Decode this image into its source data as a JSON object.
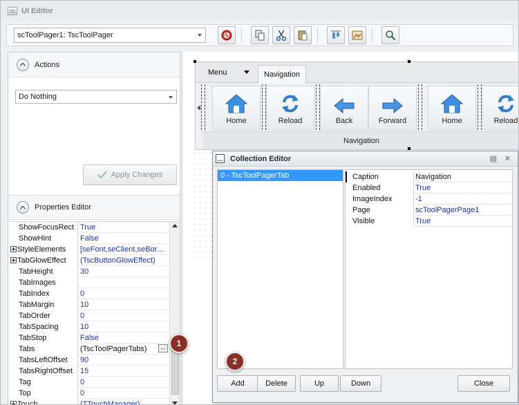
{
  "window": {
    "title": "UI Editor"
  },
  "toolbar": {
    "component_select": {
      "value": "scToolPager1: TscToolPager"
    },
    "buttons": [
      "delete-icon",
      "copy-icon",
      "cut-icon",
      "paste-icon",
      "align-icon",
      "image-icon",
      "search-icon"
    ]
  },
  "actions": {
    "header": "Actions",
    "select_value": "Do Nothing",
    "apply_label": "Apply Changes"
  },
  "properties": {
    "header": "Properties Editor",
    "rows": [
      {
        "name": "ShowFocusRect",
        "value": "True"
      },
      {
        "name": "ShowHint",
        "value": "False"
      },
      {
        "name": "StyleElements",
        "value": "[seFont,seClient,seBor…",
        "expandable": true
      },
      {
        "name": "TabGlowEffect",
        "value": "(TscButtonGlowEffect)",
        "expandable": true
      },
      {
        "name": "TabHeight",
        "value": "30"
      },
      {
        "name": "TabImages",
        "value": ""
      },
      {
        "name": "TabIndex",
        "value": "0"
      },
      {
        "name": "TabMargin",
        "value": "10"
      },
      {
        "name": "TabOrder",
        "value": "0"
      },
      {
        "name": "TabSpacing",
        "value": "10"
      },
      {
        "name": "TabStop",
        "value": "False"
      },
      {
        "name": "Tabs",
        "value": "(TscToolPagerTabs)",
        "selected": true
      },
      {
        "name": "TabsLeftOffset",
        "value": "90"
      },
      {
        "name": "TabsRightOffset",
        "value": "15"
      },
      {
        "name": "Tag",
        "value": "0"
      },
      {
        "name": "Top",
        "value": "0"
      },
      {
        "name": "Touch",
        "value": "(TTouchManager)",
        "expandable": true
      }
    ]
  },
  "designer": {
    "tabs": {
      "menu": "Menu",
      "navigation": "Navigation"
    },
    "buttons": [
      "Home",
      "Reload",
      "Back",
      "Forward",
      "Home",
      "Reload"
    ],
    "caption": "Navigation"
  },
  "collection_editor": {
    "title": "Collection Editor",
    "items": [
      "0 - TscToolPagerTab"
    ],
    "props": [
      {
        "name": "Caption",
        "value": "Navigation"
      },
      {
        "name": "Enabled",
        "value": "True"
      },
      {
        "name": "ImageIndex",
        "value": "-1"
      },
      {
        "name": "Page",
        "value": "scToolPagerPage1"
      },
      {
        "name": "Visible",
        "value": "True"
      }
    ],
    "buttons": {
      "add": "Add",
      "delete": "Delete",
      "up": "Up",
      "down": "Down",
      "close": "Close"
    }
  },
  "badges": [
    "1",
    "2"
  ],
  "colors": {
    "selection": "#3399ff",
    "value_text": "#1a34a8",
    "badge": "#8a2f26"
  }
}
